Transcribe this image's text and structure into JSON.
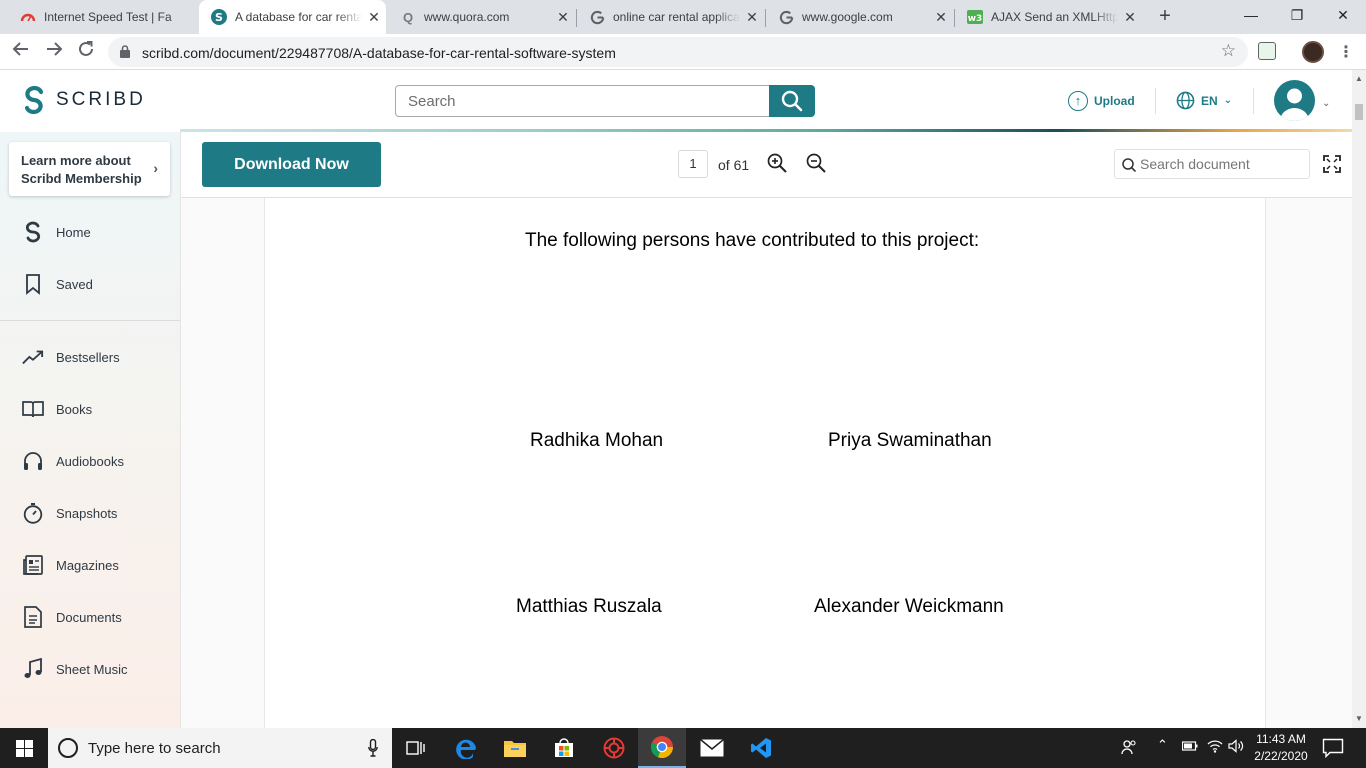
{
  "browser": {
    "tabs": [
      {
        "title": "Internet Speed Test | Fa",
        "icon": "speedtest-icon",
        "active": false
      },
      {
        "title": "A database for car renta",
        "icon": "scribd-icon",
        "active": true
      },
      {
        "title": "www.quora.com",
        "icon": "quora-icon",
        "active": false
      },
      {
        "title": "online car rental applica",
        "icon": "google-icon",
        "active": false
      },
      {
        "title": "www.google.com",
        "icon": "google-icon",
        "active": false
      },
      {
        "title": "AJAX Send an XMLHttp",
        "icon": "w3schools-icon",
        "active": false
      }
    ],
    "url": "scribd.com/document/229487708/A-database-for-car-rental-software-system"
  },
  "header": {
    "brand": "SCRIBD",
    "search_placeholder": "Search",
    "upload_label": "Upload",
    "language": "EN"
  },
  "sidebar": {
    "membership": [
      "Learn more about",
      "Scribd Membership"
    ],
    "primary": [
      {
        "label": "Home",
        "icon": "home-icon"
      },
      {
        "label": "Saved",
        "icon": "bookmark-icon"
      }
    ],
    "browse": [
      {
        "label": "Bestsellers",
        "icon": "trending-icon"
      },
      {
        "label": "Books",
        "icon": "book-icon"
      },
      {
        "label": "Audiobooks",
        "icon": "headphones-icon"
      },
      {
        "label": "Snapshots",
        "icon": "stopwatch-icon"
      },
      {
        "label": "Magazines",
        "icon": "magazine-icon"
      },
      {
        "label": "Documents",
        "icon": "document-icon"
      },
      {
        "label": "Sheet Music",
        "icon": "music-note-icon"
      }
    ]
  },
  "doc_toolbar": {
    "download_label": "Download Now",
    "current_page": "1",
    "total_pages_label": "of 61",
    "search_placeholder": "Search document"
  },
  "document": {
    "heading": "The following persons have contributed to this project:",
    "contributors": [
      "Radhika Mohan",
      "Priya Swaminathan",
      "Matthias Ruszala",
      "Alexander Weickmann"
    ]
  },
  "taskbar": {
    "search_placeholder": "Type here to search",
    "time": "11:43 AM",
    "date": "2/22/2020"
  },
  "colors": {
    "brand_teal": "#1e7b85",
    "taskbar": "#1f1f1f"
  }
}
